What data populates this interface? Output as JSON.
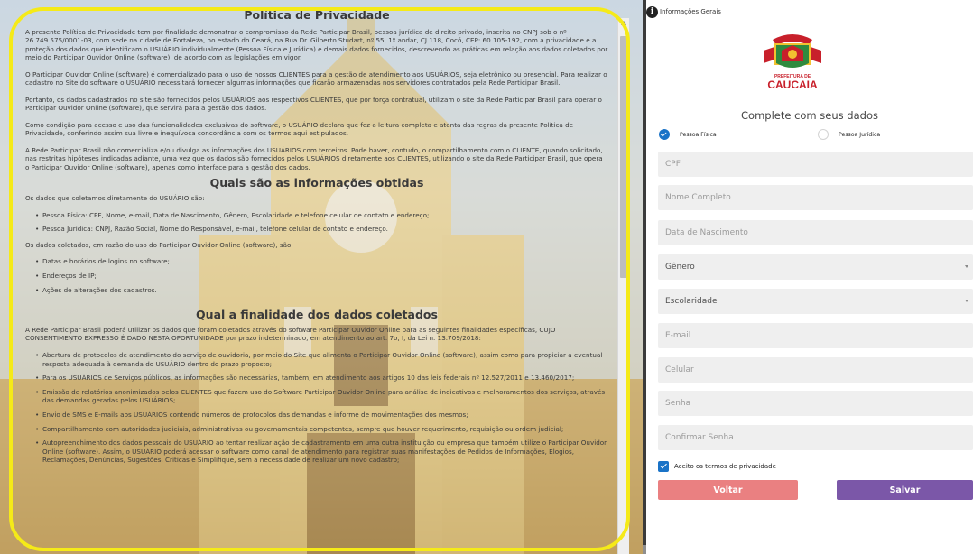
{
  "policy": {
    "title": "Política de Privacidade",
    "paragraphs": [
      "A presente Política de Privacidade tem por finalidade demonstrar o compromisso da Rede Participar Brasil, pessoa jurídica de direito privado, inscrita no CNPJ sob o nº 26.749.575/0001-03, com sede na cidade de Fortaleza, no estado do Ceará, na Rua Dr. Gilberto Studart, nº 55, 1º andar, CJ 118, Cocó, CEP: 60.105-192, com a privacidade e a proteção dos dados que identificam o USUÁRIO individualmente (Pessoa Física e Jurídica) e demais dados fornecidos, descrevendo as práticas em relação aos dados coletados por meio do Participar Ouvidor Online (software), de acordo com as legislações em vigor.",
      "O Participar Ouvidor Online (software) é comercializado para o uso de nossos CLIENTES para a gestão de atendimento aos USUÁRIOS, seja eletrônico ou presencial. Para realizar o cadastro no Site do software o USUÁRIO necessitará fornecer algumas informações que ficarão armazenadas nos servidores contratados pela Rede Participar Brasil.",
      "Portanto, os dados cadastrados no site são fornecidos pelos USUÁRIOS aos respectivos CLIENTES, que por força contratual, utilizam o site da Rede Participar Brasil para operar o Participar Ouvidor Online (software), que servirá para a gestão dos dados.",
      "Como condição para acesso e uso das funcionalidades exclusivas do software, o USUÁRIO declara que fez a leitura completa e atenta das regras da presente Política de Privacidade, conferindo assim sua livre e inequívoca concordância com os termos aqui estipulados.",
      "A Rede Participar Brasil não comercializa e/ou divulga as informações dos USUÁRIOS com terceiros. Pode haver, contudo, o compartilhamento com o CLIENTE, quando solicitado, nas restritas hipóteses indicadas adiante, uma vez que os dados são fornecidos pelos USUÁRIOS diretamente aos CLIENTES, utilizando o site da Rede Participar Brasil, que opera o Participar Ouvidor Online (software), apenas como interface para a gestão dos dados."
    ],
    "section2_title": "Quais são as informações obtidas",
    "section2_intro": "Os dados que coletamos diretamente do USUÁRIO são:",
    "section2_items": [
      "Pessoa Física: CPF, Nome, e-mail, Data de Nascimento, Gênero, Escolaridade e telefone celular de contato e endereço;",
      "Pessoa Jurídica: CNPJ, Razão Social, Nome do Responsável, e-mail, telefone celular de contato e endereço."
    ],
    "section2_intro2": "Os dados coletados, em razão do uso do Participar Ouvidor Online (software), são:",
    "section2_items2": [
      "Datas e horários de logins no software;",
      "Endereços de IP;",
      "Ações de alterações dos cadastros."
    ],
    "section3_title": "Qual a finalidade dos dados coletados",
    "section3_intro": "A Rede Participar Brasil poderá utilizar os dados que foram coletados através do software Participar Ouvidor Online para as seguintes finalidades específicas, CUJO CONSENTIMENTO EXPRESSO É DADO NESTA OPORTUNIDADE por prazo indeterminado, em atendimento ao art. 7o, I, da Lei n. 13.709/2018:",
    "section3_items": [
      "Abertura de protocolos de atendimento do serviço de ouvidoria, por meio do Site que alimenta o Participar Ouvidor Online (software), assim como para propiciar a eventual resposta adequada à demanda do USUÁRIO dentro do prazo proposto;",
      "Para os USUÁRIOS de Serviços públicos, as informações são necessárias, também, em atendimento aos artigos 10 das leis federais nº 12.527/2011 e 13.460/2017;",
      "Emissão de relatórios anonimizados pelos CLIENTES que fazem uso do Software Participar Ouvidor Online para análise de indicativos e melhoramentos dos serviços, através das demandas geradas pelos USUÁRIOS;",
      "Envio de SMS e E-mails aos USUÁRIOS contendo números de protocolos das demandas e informe de movimentações dos mesmos;",
      "Compartilhamento com autoridades judiciais, administrativas ou governamentais competentes, sempre que houver requerimento, requisição ou ordem judicial;",
      "Autopreenchimento dos dados pessoais do USUÁRIO ao tentar realizar ação de cadastramento em uma outra instituição ou empresa que também utilize o Participar Ouvidor Online (software). Assim, o USUÁRIO poderá acessar o software como canal de atendimento para registrar suas manifestações de Pedidos de Informações, Elogios, Reclamações, Denúncias, Sugestões, Críticas e Simplifique, sem a necessidade de realizar um novo cadastro;"
    ]
  },
  "header": {
    "info_label": "Informações Gerais",
    "info_icon": "info-circle-icon"
  },
  "logo": {
    "text": "PREFEITURA DE CAUCAIA",
    "colors": {
      "red": "#c8202b",
      "yellow": "#f2c230",
      "green": "#2f8a3e"
    }
  },
  "form": {
    "heading": "Complete com seus dados",
    "person_types": [
      {
        "label": "Pessoa Física",
        "selected": true
      },
      {
        "label": "Pessoa Jurídica",
        "selected": false
      }
    ],
    "fields": {
      "cpf": "CPF",
      "nome": "Nome Completo",
      "nascimento": "Data de Nascimento",
      "genero": "Gênero",
      "escolaridade": "Escolaridade",
      "email": "E-mail",
      "celular": "Celular",
      "senha": "Senha",
      "confirmar": "Confirmar Senha"
    },
    "terms_label": "Aceito os termos de privacidade",
    "terms_checked": true,
    "back_label": "Voltar",
    "save_label": "Salvar"
  },
  "colors": {
    "highlight": "#f5ea18",
    "accent_blue": "#1a73c7",
    "back_button": "#ea8081",
    "save_button": "#7b57a8"
  }
}
